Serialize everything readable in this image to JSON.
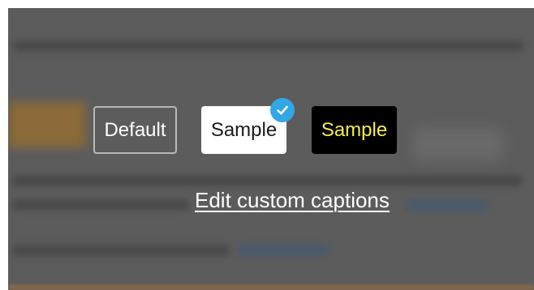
{
  "captions": {
    "options": [
      {
        "label": "Default",
        "style": "outline",
        "text_color": "#ffffff",
        "selected": false
      },
      {
        "label": "Sample",
        "style": "white",
        "text_color": "#1a1a1a",
        "background": "#ffffff",
        "selected": true
      },
      {
        "label": "Sample",
        "style": "black-yellow",
        "text_color": "#f2ec58",
        "background": "#000000",
        "selected": false
      }
    ],
    "selected_icon": "check-circle-icon",
    "edit_link": "Edit custom captions"
  },
  "colors": {
    "overlay": "#5c5c5c",
    "check_badge": "#33a7e4"
  }
}
